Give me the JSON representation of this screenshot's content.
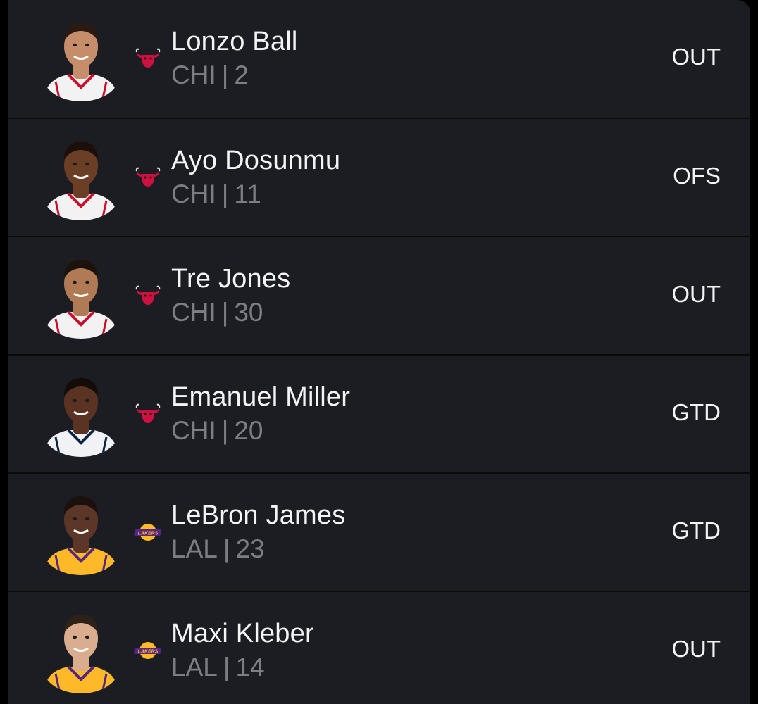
{
  "players": [
    {
      "name": "Lonzo Ball",
      "team": "CHI",
      "number": "2",
      "status": "OUT",
      "logo": "bulls-logo",
      "skin": "#c58d6a",
      "hair": "#2a1a12",
      "jersey": "#f2f2f2",
      "trim": "#c8102e"
    },
    {
      "name": "Ayo Dosunmu",
      "team": "CHI",
      "number": "11",
      "status": "OFS",
      "logo": "bulls-logo",
      "skin": "#6b3e26",
      "hair": "#1a0f0a",
      "jersey": "#f2f2f2",
      "trim": "#c8102e"
    },
    {
      "name": "Tre Jones",
      "team": "CHI",
      "number": "30",
      "status": "OUT",
      "logo": "bulls-logo",
      "skin": "#b07a55",
      "hair": "#1c120c",
      "jersey": "#f2f2f2",
      "trim": "#c8102e"
    },
    {
      "name": "Emanuel Miller",
      "team": "CHI",
      "number": "20",
      "status": "GTD",
      "logo": "bulls-logo",
      "skin": "#5a3322",
      "hair": "#140c08",
      "jersey": "#f0f2f5",
      "trim": "#0c2340"
    },
    {
      "name": "LeBron James",
      "team": "LAL",
      "number": "23",
      "status": "GTD",
      "logo": "lakers-logo",
      "skin": "#5c3626",
      "hair": "#1a110c",
      "jersey": "#fdb927",
      "trim": "#552583"
    },
    {
      "name": "Maxi Kleber",
      "team": "LAL",
      "number": "14",
      "status": "OUT",
      "logo": "lakers-logo",
      "skin": "#d9ad8e",
      "hair": "#2e2118",
      "jersey": "#fdb927",
      "trim": "#552583"
    }
  ],
  "colors": {
    "background": "#1c1d22",
    "divider": "#0a0a0c",
    "name_text": "#f4f4f6",
    "meta_text": "#7d7e84",
    "bulls_red": "#ce1141",
    "lakers_purple": "#552583",
    "lakers_gold": "#fdb927"
  }
}
